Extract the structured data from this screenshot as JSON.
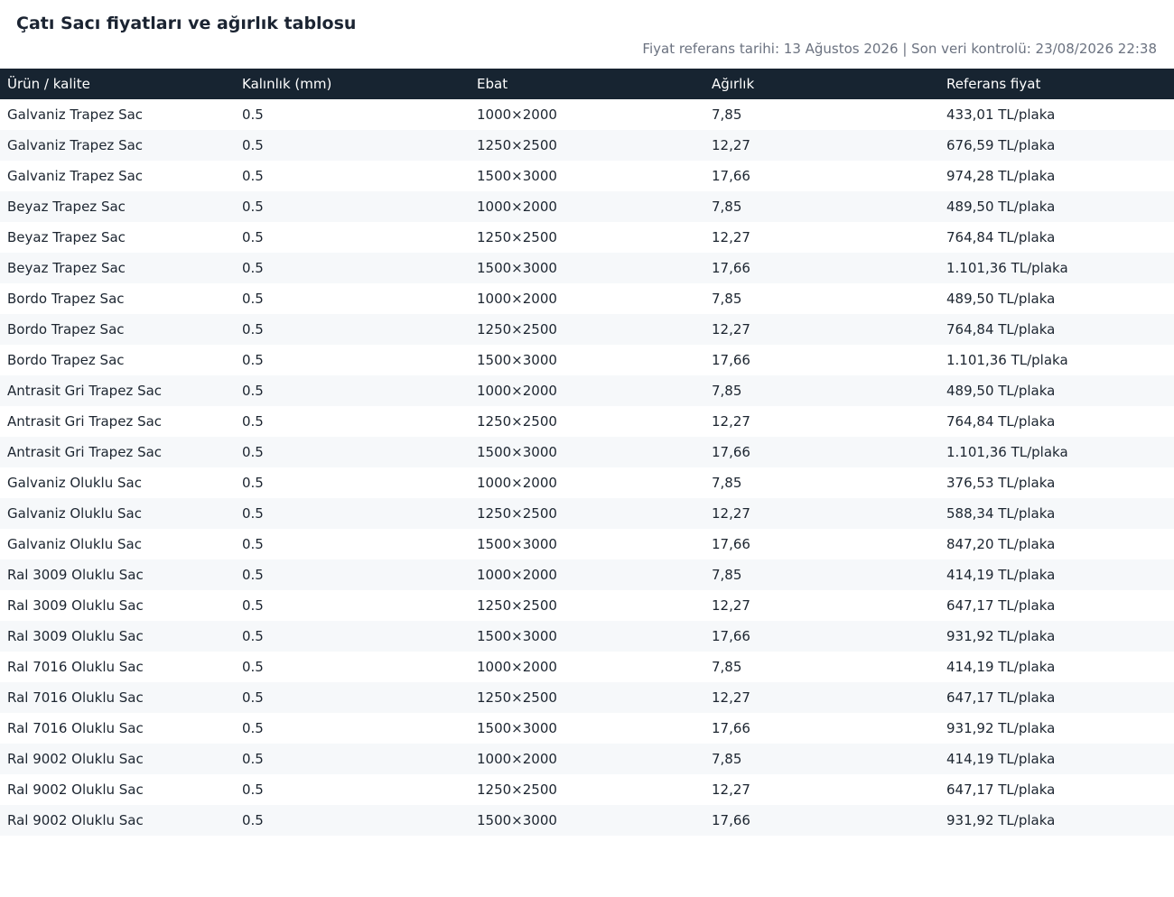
{
  "header": {
    "title": "Çatı Sacı fiyatları ve ağırlık tablosu",
    "meta": "Fiyat referans tarihi: 13 Ağustos 2026 | Son veri kontrolü: 23/08/2026 22:38"
  },
  "table": {
    "columns": [
      "Ürün / kalite",
      "Kalınlık (mm)",
      "Ebat",
      "Ağırlık",
      "Referans fiyat"
    ],
    "rows": [
      [
        "Galvaniz Trapez Sac",
        "0.5",
        "1000×2000",
        "7,85",
        "433,01 TL/plaka"
      ],
      [
        "Galvaniz Trapez Sac",
        "0.5",
        "1250×2500",
        "12,27",
        "676,59 TL/plaka"
      ],
      [
        "Galvaniz Trapez Sac",
        "0.5",
        "1500×3000",
        "17,66",
        "974,28 TL/plaka"
      ],
      [
        "Beyaz Trapez Sac",
        "0.5",
        "1000×2000",
        "7,85",
        "489,50 TL/plaka"
      ],
      [
        "Beyaz Trapez Sac",
        "0.5",
        "1250×2500",
        "12,27",
        "764,84 TL/plaka"
      ],
      [
        "Beyaz Trapez Sac",
        "0.5",
        "1500×3000",
        "17,66",
        "1.101,36 TL/plaka"
      ],
      [
        "Bordo Trapez Sac",
        "0.5",
        "1000×2000",
        "7,85",
        "489,50 TL/plaka"
      ],
      [
        "Bordo Trapez Sac",
        "0.5",
        "1250×2500",
        "12,27",
        "764,84 TL/plaka"
      ],
      [
        "Bordo Trapez Sac",
        "0.5",
        "1500×3000",
        "17,66",
        "1.101,36 TL/plaka"
      ],
      [
        "Antrasit Gri Trapez Sac",
        "0.5",
        "1000×2000",
        "7,85",
        "489,50 TL/plaka"
      ],
      [
        "Antrasit Gri Trapez Sac",
        "0.5",
        "1250×2500",
        "12,27",
        "764,84 TL/plaka"
      ],
      [
        "Antrasit Gri Trapez Sac",
        "0.5",
        "1500×3000",
        "17,66",
        "1.101,36 TL/plaka"
      ],
      [
        "Galvaniz Oluklu Sac",
        "0.5",
        "1000×2000",
        "7,85",
        "376,53 TL/plaka"
      ],
      [
        "Galvaniz Oluklu Sac",
        "0.5",
        "1250×2500",
        "12,27",
        "588,34 TL/plaka"
      ],
      [
        "Galvaniz Oluklu Sac",
        "0.5",
        "1500×3000",
        "17,66",
        "847,20 TL/plaka"
      ],
      [
        "Ral 3009 Oluklu Sac",
        "0.5",
        "1000×2000",
        "7,85",
        "414,19 TL/plaka"
      ],
      [
        "Ral 3009 Oluklu Sac",
        "0.5",
        "1250×2500",
        "12,27",
        "647,17 TL/plaka"
      ],
      [
        "Ral 3009 Oluklu Sac",
        "0.5",
        "1500×3000",
        "17,66",
        "931,92 TL/plaka"
      ],
      [
        "Ral 7016 Oluklu Sac",
        "0.5",
        "1000×2000",
        "7,85",
        "414,19 TL/plaka"
      ],
      [
        "Ral 7016 Oluklu Sac",
        "0.5",
        "1250×2500",
        "12,27",
        "647,17 TL/plaka"
      ],
      [
        "Ral 7016 Oluklu Sac",
        "0.5",
        "1500×3000",
        "17,66",
        "931,92 TL/plaka"
      ],
      [
        "Ral 9002 Oluklu Sac",
        "0.5",
        "1000×2000",
        "7,85",
        "414,19 TL/plaka"
      ],
      [
        "Ral 9002 Oluklu Sac",
        "0.5",
        "1250×2500",
        "12,27",
        "647,17 TL/plaka"
      ],
      [
        "Ral 9002 Oluklu Sac",
        "0.5",
        "1500×3000",
        "17,66",
        "931,92 TL/plaka"
      ]
    ]
  },
  "colors": {
    "header_background": "#172431",
    "header_text": "#ffffff",
    "stripe_background": "#f6f8fa",
    "meta_text": "#6b7280"
  }
}
